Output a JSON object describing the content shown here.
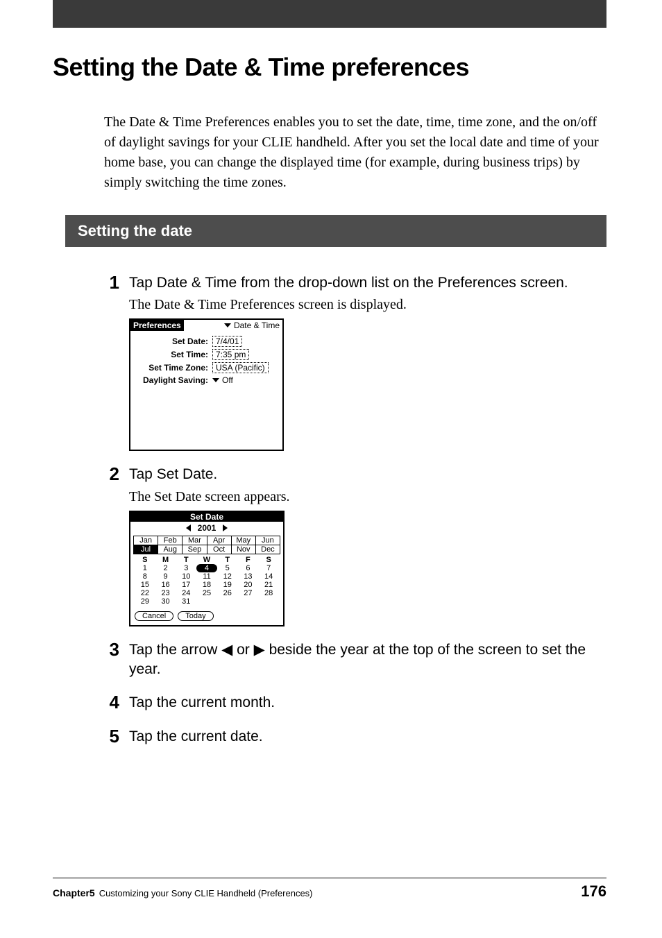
{
  "page": {
    "title": "Setting the Date & Time preferences",
    "intro": "The Date & Time Preferences enables you to set the date, time, time zone, and the on/off of daylight savings for your CLIE handheld. After you set the local date and time of your home base, you can change the displayed time (for example, during business trips) by simply switching the time zones.",
    "section_heading": "Setting the date"
  },
  "steps": {
    "s1": {
      "num": "1",
      "head": "Tap Date & Time from the drop-down list on the Preferences screen.",
      "sub": "The Date & Time Preferences screen is displayed."
    },
    "s2": {
      "num": "2",
      "head": "Tap Set Date.",
      "sub": "The Set Date screen appears."
    },
    "s3": {
      "num": "3",
      "head_a": "Tap the arrow ",
      "head_b": " or ",
      "head_c": " beside the year at the top of the screen to set the year.",
      "arrow_l": "◀",
      "arrow_r": "▶"
    },
    "s4": {
      "num": "4",
      "head": "Tap the current month."
    },
    "s5": {
      "num": "5",
      "head": "Tap the current date."
    }
  },
  "prefs": {
    "title": "Preferences",
    "menu": "Date & Time",
    "rows": {
      "setdate": {
        "label": "Set Date:",
        "value": "7/4/01"
      },
      "settime": {
        "label": "Set Time:",
        "value": "7:35 pm"
      },
      "settz": {
        "label": "Set Time Zone:",
        "value": "USA (Pacific)"
      },
      "dst": {
        "label": "Daylight Saving:",
        "value": "Off"
      }
    }
  },
  "setdate": {
    "title": "Set Date",
    "year": "2001",
    "months": [
      "Jan",
      "Feb",
      "Mar",
      "Apr",
      "May",
      "Jun",
      "Jul",
      "Aug",
      "Sep",
      "Oct",
      "Nov",
      "Dec"
    ],
    "selected_month_index": 6,
    "dow": [
      "S",
      "M",
      "T",
      "W",
      "T",
      "F",
      "S"
    ],
    "days": [
      "1",
      "2",
      "3",
      "4",
      "5",
      "6",
      "7",
      "8",
      "9",
      "10",
      "11",
      "12",
      "13",
      "14",
      "15",
      "16",
      "17",
      "18",
      "19",
      "20",
      "21",
      "22",
      "23",
      "24",
      "25",
      "26",
      "27",
      "28",
      "29",
      "30",
      "31"
    ],
    "selected_day": "4",
    "buttons": {
      "cancel": "Cancel",
      "today": "Today"
    }
  },
  "footer": {
    "chapter": "Chapter5",
    "subtitle": "Customizing your Sony CLIE Handheld (Preferences)",
    "page": "176"
  }
}
